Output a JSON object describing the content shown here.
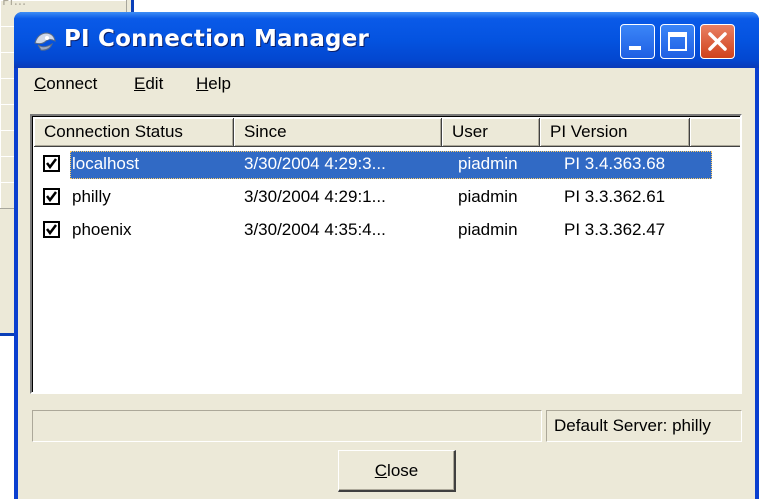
{
  "background_window": {
    "label": "Pr..."
  },
  "window": {
    "title": "PI Connection Manager",
    "controls": [
      "minimize",
      "maximize",
      "close"
    ]
  },
  "menu": {
    "connect": {
      "label": "Connect",
      "mnemonic": "C",
      "rest": "onnect"
    },
    "edit": {
      "label": "Edit",
      "mnemonic": "E",
      "rest": "dit"
    },
    "help": {
      "label": "Help",
      "mnemonic": "H",
      "rest": "elp"
    }
  },
  "table": {
    "headers": {
      "status": "Connection Status",
      "since": "Since",
      "user": "User",
      "version": "PI Version"
    },
    "rows": [
      {
        "name": "localhost",
        "since": "3/30/2004 4:29:3...",
        "user": "piadmin",
        "version": "PI 3.4.363.68",
        "checked": true,
        "selected": true
      },
      {
        "name": "philly",
        "since": "3/30/2004 4:29:1...",
        "user": "piadmin",
        "version": "PI 3.3.362.61",
        "checked": true,
        "selected": false
      },
      {
        "name": "phoenix",
        "since": "3/30/2004 4:35:4...",
        "user": "piadmin",
        "version": "PI 3.3.362.47",
        "checked": true,
        "selected": false
      }
    ]
  },
  "status_bar": {
    "left": "",
    "right": "Default Server: philly"
  },
  "close_button": {
    "label": "Close",
    "mnemonic": "C",
    "rest": "lose"
  },
  "colors": {
    "titlebar": "#0453e0",
    "selection": "#316ac5",
    "face": "#ece9d8",
    "close_control": "#d0421c"
  }
}
